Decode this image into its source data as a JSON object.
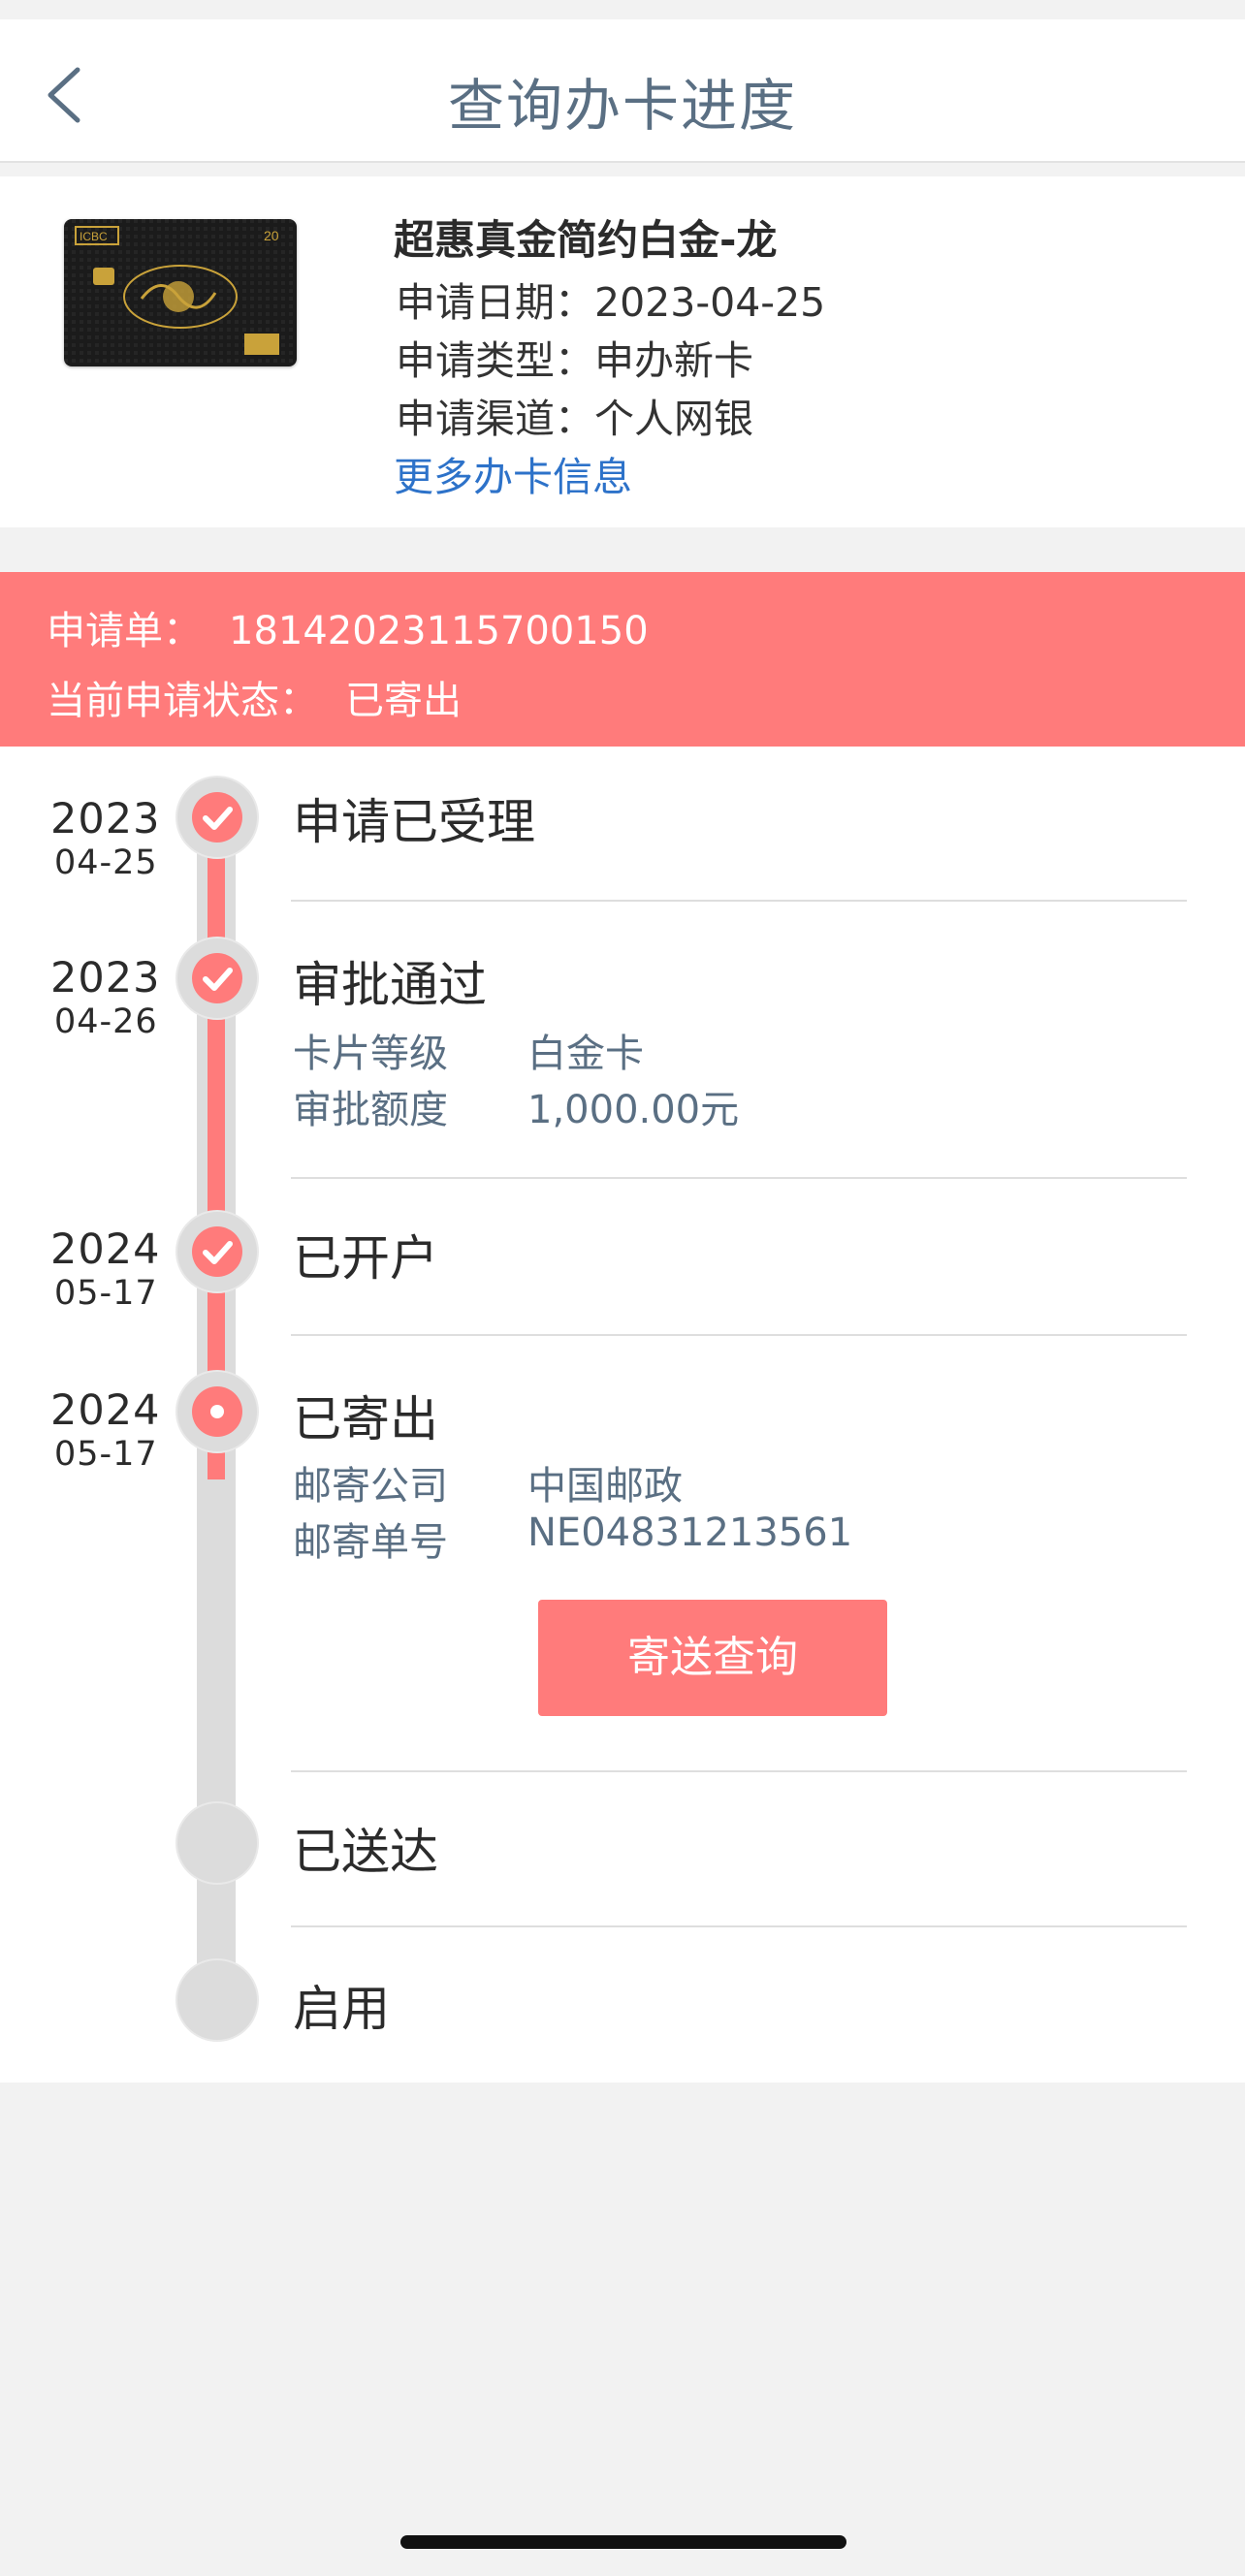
{
  "header": {
    "title": "查询办卡进度"
  },
  "card": {
    "name": "超惠真金简约白金-龙",
    "fields": [
      {
        "label": "申请日期：",
        "value": "2023-04-25"
      },
      {
        "label": "申请类型：",
        "value": "申办新卡"
      },
      {
        "label": "申请渠道：",
        "value": "个人网银"
      }
    ],
    "more_link": "更多办卡信息",
    "image": {
      "brand_text": "ICBC",
      "number_text": "20",
      "colors": {
        "bg": "#1b1b1b",
        "gold": "#c9a23a"
      }
    }
  },
  "status": {
    "order_label": "申请单：",
    "order_number": "18142023115700150",
    "state_label": "当前申请状态：",
    "state_value": "已寄出"
  },
  "timeline": [
    {
      "year": "2023",
      "md": "04-25",
      "title": "申请已受理",
      "state": "done",
      "details": []
    },
    {
      "year": "2023",
      "md": "04-26",
      "title": "审批通过",
      "state": "done",
      "details": [
        {
          "label": "卡片等级",
          "value": "白金卡"
        },
        {
          "label": "审批额度",
          "value": "1,000.00元"
        }
      ]
    },
    {
      "year": "2024",
      "md": "05-17",
      "title": "已开户",
      "state": "done",
      "details": []
    },
    {
      "year": "2024",
      "md": "05-17",
      "title": "已寄出",
      "state": "current",
      "details": [
        {
          "label": "邮寄公司",
          "value": "中国邮政"
        },
        {
          "label": "邮寄单号",
          "value": "NE04831213561"
        }
      ],
      "action_label": "寄送查询"
    },
    {
      "year": "",
      "md": "",
      "title": "已送达",
      "state": "pending",
      "details": []
    },
    {
      "year": "",
      "md": "",
      "title": "启用",
      "state": "pending",
      "details": []
    }
  ],
  "colors": {
    "accent": "#ff7b7b",
    "link": "#2d72c9",
    "muted": "#5a6f83",
    "rail": "#dcdcdc"
  },
  "icons": {
    "back": "chevron-left-icon",
    "done": "check-icon",
    "current": "dot-icon"
  }
}
